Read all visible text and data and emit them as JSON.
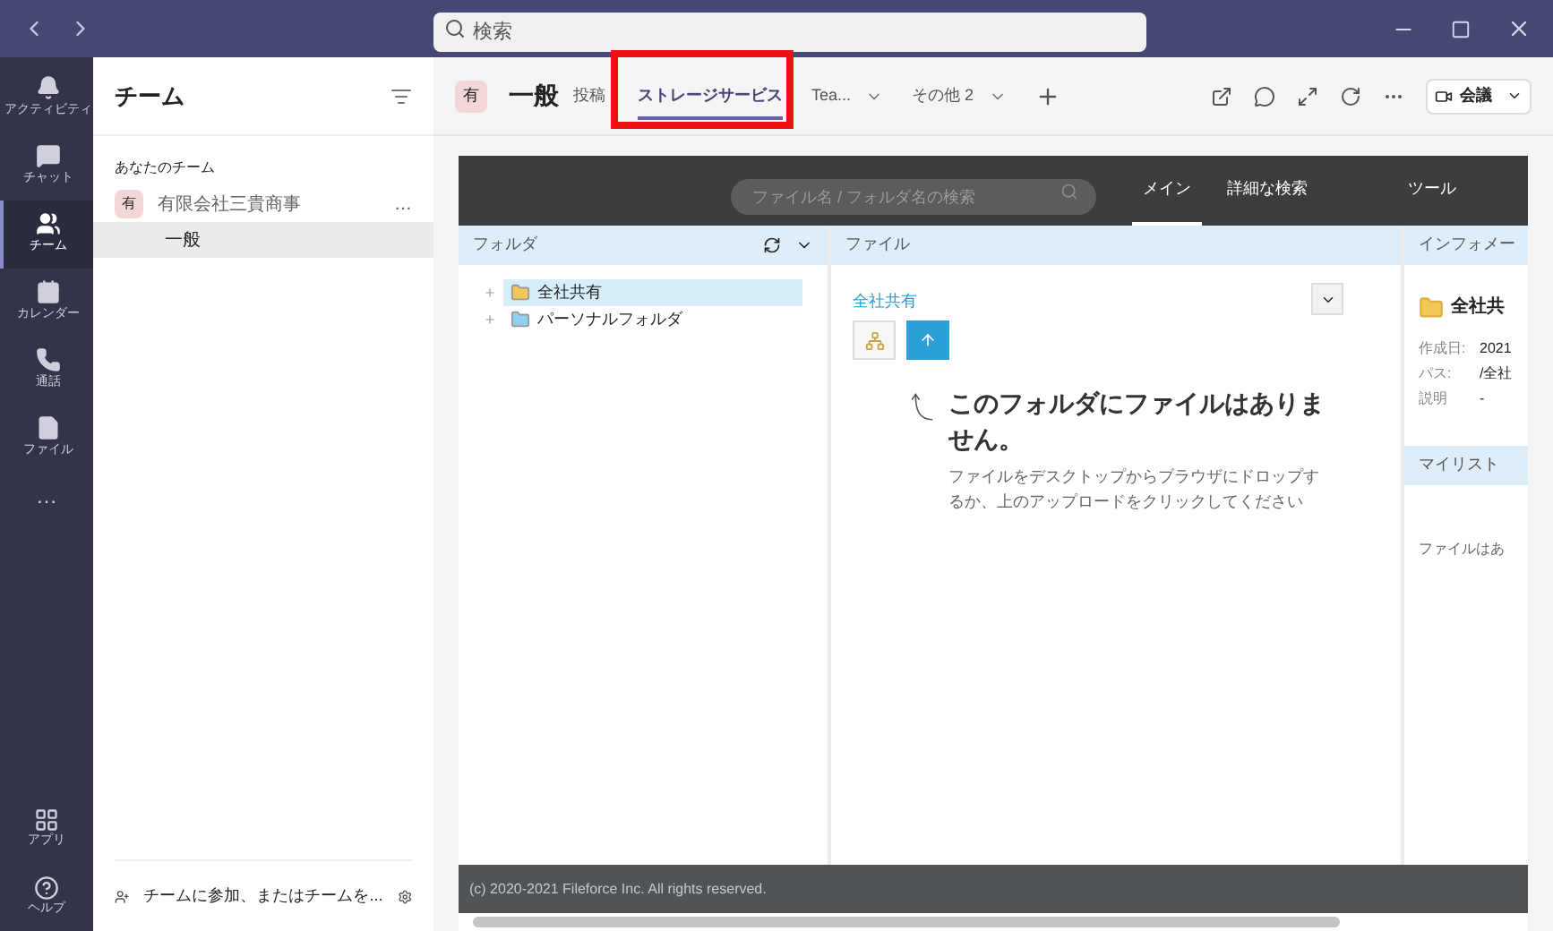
{
  "titlebar": {
    "search": {
      "placeholder": "検索"
    }
  },
  "rail": {
    "items": [
      {
        "label": "アクティビティ",
        "selected": false
      },
      {
        "label": "チャット",
        "selected": false
      },
      {
        "label": "チーム",
        "selected": true
      },
      {
        "label": "カレンダー",
        "selected": false
      },
      {
        "label": "通話",
        "selected": false
      },
      {
        "label": "ファイル",
        "selected": false
      }
    ],
    "more": "…",
    "bottom": [
      {
        "label": "アプリ"
      },
      {
        "label": "ヘルプ"
      }
    ]
  },
  "teams_panel": {
    "title": "チーム",
    "section": "あなたのチーム",
    "teams": [
      {
        "avatar": "有",
        "name": "有限会社三貴商事",
        "more": "…",
        "channels": [
          {
            "name": "一般",
            "selected": true
          }
        ]
      }
    ],
    "join": "チームに参加、またはチームを..."
  },
  "channel_header": {
    "avatar": "有",
    "name": "一般",
    "tabs": [
      {
        "label": "投稿",
        "selected": false
      },
      {
        "label": "ストレージサービス",
        "selected": true
      },
      {
        "label": "Tea...",
        "selected": false
      }
    ],
    "more_tabs": "その他 2",
    "meeting": "会議"
  },
  "app": {
    "search": {
      "placeholder": "ファイル名 / フォルダ名の検索"
    },
    "nav": [
      {
        "label": "メイン",
        "selected": true
      },
      {
        "label": "詳細な検索",
        "selected": false
      },
      {
        "label": "ツール",
        "selected": false
      }
    ],
    "folder_panel": {
      "title": "フォルダ",
      "tree": [
        {
          "name": "全社共有",
          "selected": true,
          "color": "#f3c85a"
        },
        {
          "name": "パーソナルフォルダ",
          "selected": false,
          "color": "#8fd0ef"
        }
      ]
    },
    "file_panel": {
      "title": "ファイル",
      "breadcrumb": "全社共有",
      "empty_title": "このフォルダにファイルはありません。",
      "empty_text": "ファイルをデスクトップからブラウザにドロップするか、上のアップロードをクリックしてください"
    },
    "info_panel": {
      "title": "インフォメー",
      "folder": "全社共",
      "fields": [
        {
          "label": "作成日:",
          "value": "2021"
        },
        {
          "label": "パス:",
          "value": "/全社"
        },
        {
          "label": "説明",
          "value": "-"
        }
      ],
      "mylist": "マイリスト",
      "mylist_text": "ファイルはあ"
    },
    "footer": "(c) 2020-2021 Fileforce Inc. All rights reserved."
  }
}
